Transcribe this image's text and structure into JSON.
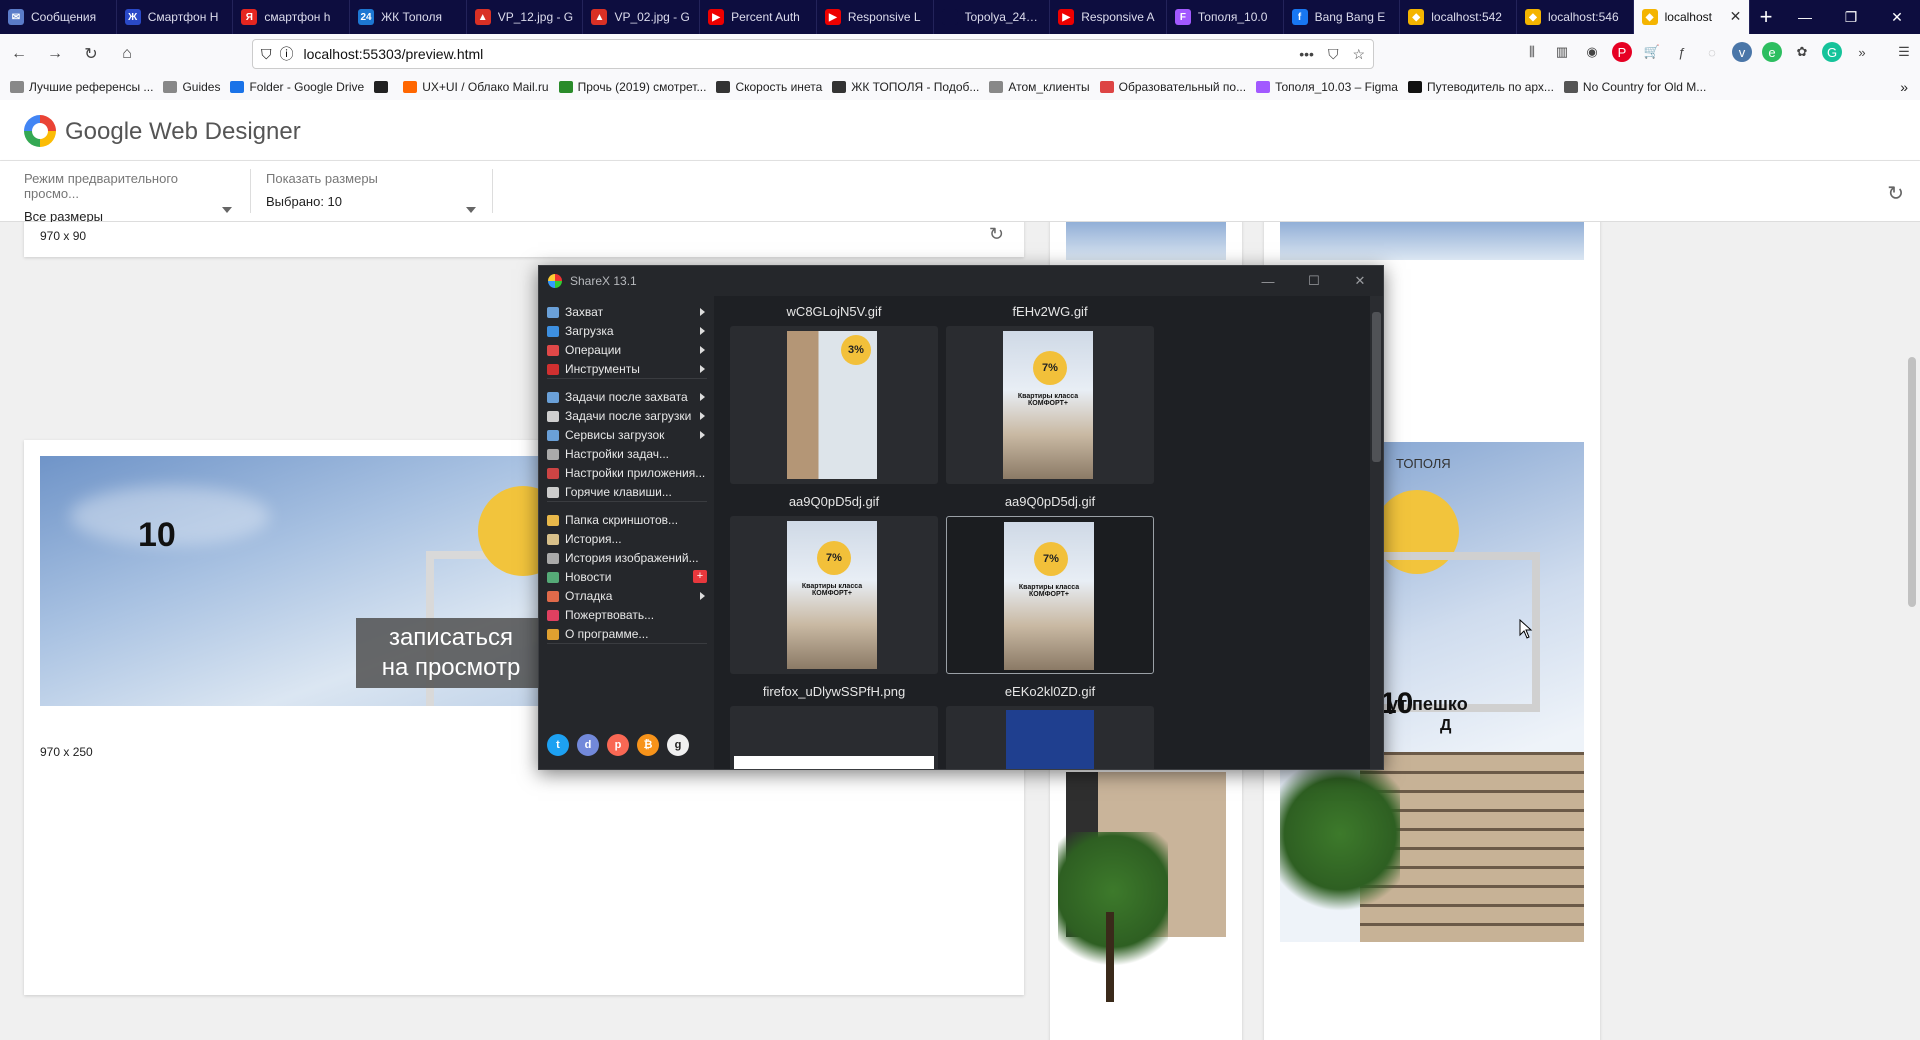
{
  "browser": {
    "tabs": [
      {
        "label": "Сообщения",
        "color": "#5b7cc9",
        "glyph": "✉"
      },
      {
        "label": "Смартфон Н",
        "color": "#2a49c8",
        "glyph": "Ж"
      },
      {
        "label": "смартфон h",
        "color": "#e52620",
        "glyph": "Я"
      },
      {
        "label": "ЖК Тополя",
        "color": "#1d77d2",
        "glyph": "24"
      },
      {
        "label": "VP_12.jpg - G",
        "color": "#d93025",
        "glyph": "▲"
      },
      {
        "label": "VP_02.jpg - G",
        "color": "#d93025",
        "glyph": "▲"
      },
      {
        "label": "Percent Auth",
        "color": "#e00",
        "glyph": "▶"
      },
      {
        "label": "Responsive L",
        "color": "#e00",
        "glyph": "▶"
      },
      {
        "label": "Topolya_240_400",
        "color": "#0d0d3f",
        "glyph": ""
      },
      {
        "label": "Responsive A",
        "color": "#e00",
        "glyph": "▶"
      },
      {
        "label": "Тополя_10.0",
        "color": "#a259ff",
        "glyph": "F"
      },
      {
        "label": "Bang Bang E",
        "color": "#1877f2",
        "glyph": "f"
      },
      {
        "label": "localhost:542",
        "color": "#f4b400",
        "glyph": "◆"
      },
      {
        "label": "localhost:546",
        "color": "#f4b400",
        "glyph": "◆"
      },
      {
        "label": "localhost",
        "color": "#f4b400",
        "glyph": "◆",
        "active": true
      }
    ],
    "new_tab": "+",
    "url": "localhost:55303/preview.html",
    "bookmarks": [
      {
        "label": "Лучшие референсы ...",
        "color": "#888"
      },
      {
        "label": "Guides",
        "color": "#888"
      },
      {
        "label": "Folder - Google Drive",
        "color": "#1a73e8"
      },
      {
        "label": "",
        "color": "#222"
      },
      {
        "label": "UX+UI / Облако Mail.ru",
        "color": "#f60"
      },
      {
        "label": "Прочь (2019) смотрет...",
        "color": "#2a8b2a"
      },
      {
        "label": "Скорость инета",
        "color": "#333"
      },
      {
        "label": "ЖК ТОПОЛЯ - Подоб...",
        "color": "#333"
      },
      {
        "label": "Атом_клиенты",
        "color": "#888"
      },
      {
        "label": "Образовательный по...",
        "color": "#d44"
      },
      {
        "label": "Тополя_10.03 – Figma",
        "color": "#a259ff"
      },
      {
        "label": "Путеводитель по арх...",
        "color": "#111"
      },
      {
        "label": "No Country for Old M...",
        "color": "#555"
      }
    ]
  },
  "gwd": {
    "app_title": "Google Web Designer",
    "preview_mode_label": "Режим предварительного просмо...",
    "preview_mode_value": "Все размеры",
    "show_sizes_label": "Показать размеры",
    "show_sizes_value": "Выбрано: 10"
  },
  "preview": {
    "card1_label": "970 x 90",
    "card2_label": "970 x 250",
    "banner_number": "10",
    "banner_number_right": "10",
    "banner_cta_line1": "записаться",
    "banner_cta_line2": "на просмотр",
    "brand": "ТОПОЛЯ",
    "banner_right_text": "ут пешко",
    "banner_right_text2": "Д"
  },
  "sharex": {
    "title": "ShareX 13.1",
    "menu": [
      {
        "label": "Захват",
        "arrow": true,
        "color": "#6aa0d8"
      },
      {
        "label": "Загрузка",
        "arrow": true,
        "color": "#3d8fe0"
      },
      {
        "label": "Операции",
        "arrow": true,
        "color": "#e04848"
      },
      {
        "label": "Инструменты",
        "arrow": true,
        "color": "#d03030"
      },
      {
        "label": "Задачи после захвата",
        "arrow": true,
        "color": "#6aa0d8"
      },
      {
        "label": "Задачи после загрузки",
        "arrow": true,
        "color": "#cfcfcf"
      },
      {
        "label": "Сервисы загрузок",
        "arrow": true,
        "color": "#6aa0d8"
      },
      {
        "label": "Настройки задач...",
        "arrow": false,
        "color": "#aaa"
      },
      {
        "label": "Настройки приложения...",
        "arrow": false,
        "color": "#c44"
      },
      {
        "label": "Горячие клавиши...",
        "arrow": false,
        "color": "#ccc"
      },
      {
        "label": "Папка скриншотов...",
        "arrow": false,
        "color": "#e8b84a"
      },
      {
        "label": "История...",
        "arrow": false,
        "color": "#d8c08a"
      },
      {
        "label": "История изображений...",
        "arrow": false,
        "color": "#aaa"
      },
      {
        "label": "Новости",
        "arrow": false,
        "badge": "+",
        "color": "#5a7"
      },
      {
        "label": "Отладка",
        "arrow": true,
        "color": "#e06a4a"
      },
      {
        "label": "Пожертвовать...",
        "arrow": false,
        "color": "#e04060"
      },
      {
        "label": "О программе...",
        "arrow": false,
        "color": "#e0a030"
      }
    ],
    "social": [
      {
        "name": "twitter-icon",
        "color": "#1da1f2",
        "glyph": "t"
      },
      {
        "name": "discord-icon",
        "color": "#7289da",
        "glyph": "d"
      },
      {
        "name": "patreon-icon",
        "color": "#f96854",
        "glyph": "p"
      },
      {
        "name": "bitcoin-icon",
        "color": "#f7931a",
        "glyph": "₿"
      },
      {
        "name": "github-icon",
        "color": "#f0f0f0",
        "glyph": "g"
      }
    ],
    "files": [
      {
        "name": "wC8GLojN5V.gif",
        "badge": "3%"
      },
      {
        "name": "fEHv2WG.gif",
        "badge": "7%",
        "caption": "Квартиры класса КОМФОРТ+"
      },
      {
        "name": "aa9Q0pD5dj.gif",
        "badge": "7%",
        "caption": "Квартиры класса КОМФОРТ+"
      },
      {
        "name": "aa9Q0pD5dj.gif",
        "badge": "7%",
        "caption": "Квартиры класса КОМФОРТ+",
        "selected": true
      },
      {
        "name": "firefox_uDlywSSPfH.png"
      },
      {
        "name": "eEKo2kl0ZD.gif"
      }
    ]
  }
}
